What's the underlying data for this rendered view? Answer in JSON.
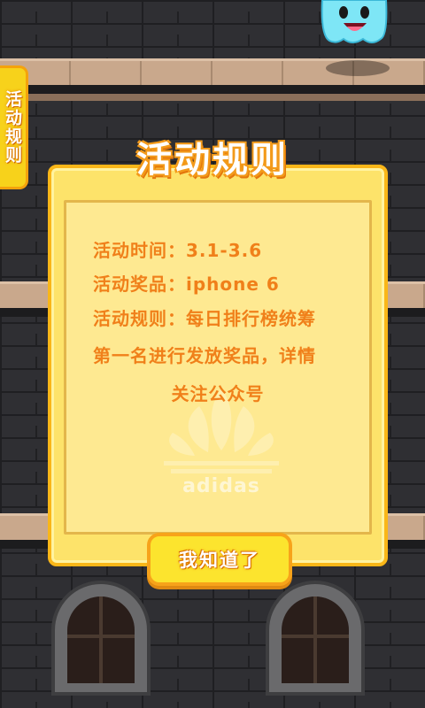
{
  "side_tab": {
    "label": "活动规则"
  },
  "modal": {
    "title": "活动规则",
    "lines": [
      "活动时间：3.1-3.6",
      "活动奖品：iphone 6",
      "活动规则：每日排行榜统筹",
      "第一名进行发放奖品，详情",
      "关注公众号"
    ],
    "watermark": "adidas",
    "confirm_button": "我知道了"
  },
  "colors": {
    "modal_bg": "#fde36a",
    "accent_orange": "#f0801a",
    "button_yellow": "#fce42e"
  },
  "icons": [
    "ghost-character-icon",
    "adidas-logo-icon",
    "window-arch-icon"
  ]
}
